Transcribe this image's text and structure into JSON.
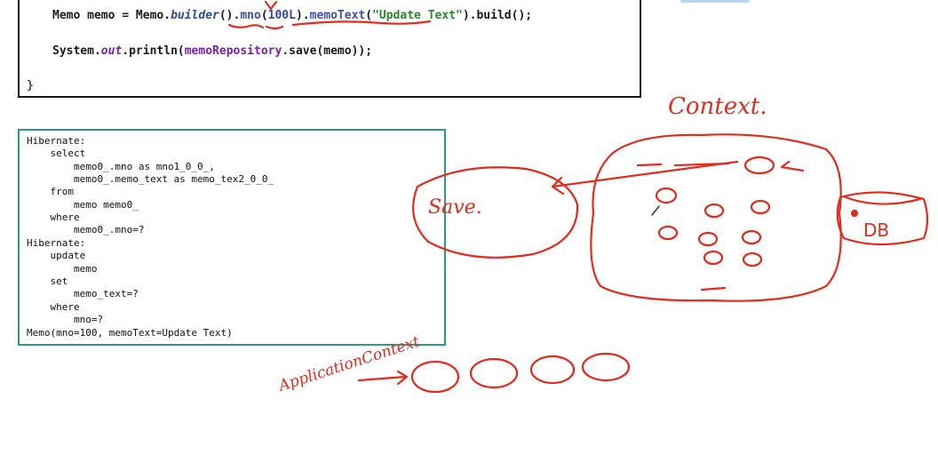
{
  "code": {
    "line1": {
      "a": "Memo memo = Memo.",
      "b": "builder",
      "c": "().",
      "d": "mno",
      "e": "(",
      "f": "100L",
      "g": ").",
      "h": "memoText",
      "i": "(",
      "j": "\"Update Text\"",
      "k": ").build();"
    },
    "line2": {
      "a": "System.",
      "b": "out",
      "c": ".println(",
      "d": "memoRepository",
      "e": ".save(memo));"
    },
    "closing_brace": "}"
  },
  "console": {
    "lines": [
      "Hibernate:",
      "    select",
      "        memo0_.mno as mno1_0_0_,",
      "        memo0_.memo_text as memo_tex2_0_0_",
      "    from",
      "        memo memo0_",
      "    where",
      "        memo0_.mno=?",
      "Hibernate:",
      "    update",
      "        memo",
      "    set",
      "        memo_text=?",
      "    where",
      "        mno=?",
      "Memo(mno=100, memoText=Update Text)"
    ]
  },
  "annotations": {
    "context_label": "Context.",
    "save_label": "Save.",
    "db_label": "DB",
    "app_context_label": "ApplicationContext"
  },
  "colors": {
    "ink": "#e02b1f",
    "console_border": "#2e9a86"
  }
}
